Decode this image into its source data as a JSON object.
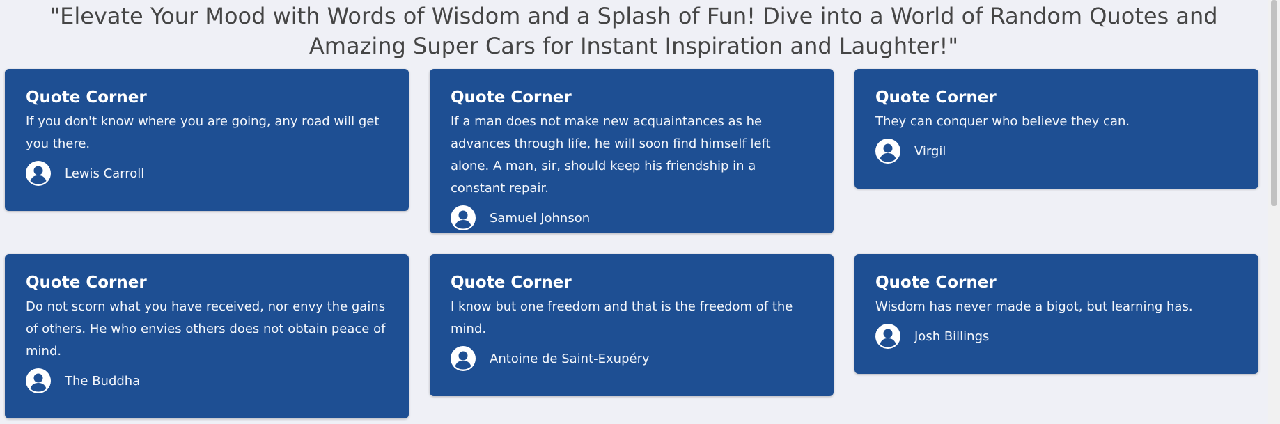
{
  "headline": "\"Elevate Your Mood with Words of Wisdom and a Splash of Fun! Dive into a World of Random Quotes and Amazing Super Cars for Instant Inspiration and Laughter!\"",
  "cards": [
    {
      "title": "Quote Corner",
      "quote": "If you don't know where you are going, any road will get you there.",
      "author": "Lewis Carroll",
      "icon": "user-avatar-icon"
    },
    {
      "title": "Quote Corner",
      "quote": "If a man does not make new acquaintances as he advances through life, he will soon find himself left alone. A man, sir, should keep his friendship in a constant repair.",
      "author": "Samuel Johnson",
      "icon": "user-avatar-icon"
    },
    {
      "title": "Quote Corner",
      "quote": "They can conquer who believe they can.",
      "author": "Virgil",
      "icon": "user-avatar-icon"
    },
    {
      "title": "Quote Corner",
      "quote": "Do not scorn what you have received, nor envy the gains of others. He who envies others does not obtain peace of mind.",
      "author": "The Buddha",
      "icon": "user-avatar-icon"
    },
    {
      "title": "Quote Corner",
      "quote": "I know but one freedom and that is the freedom of the mind.",
      "author": "Antoine de Saint-Exupéry",
      "icon": "user-avatar-icon"
    },
    {
      "title": "Quote Corner",
      "quote": "Wisdom has never made a bigot, but learning has.",
      "author": "Josh Billings",
      "icon": "user-avatar-icon"
    }
  ],
  "colors": {
    "background": "#eff0f6",
    "card": "#1e4f93",
    "headline_text": "#454545",
    "card_text": "#ffffff"
  }
}
